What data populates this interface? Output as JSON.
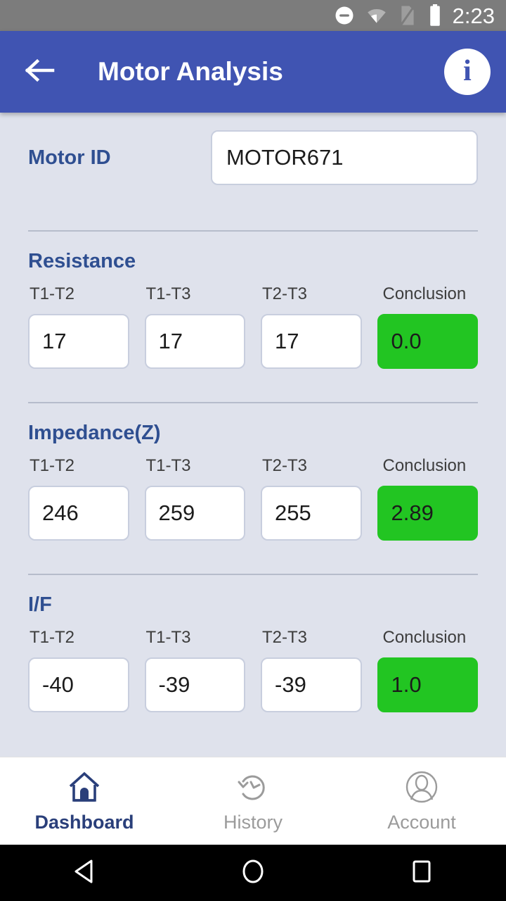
{
  "status_bar": {
    "time": "2:23",
    "icons": [
      "do-not-disturb-icon",
      "wifi-icon",
      "no-sim-icon",
      "battery-icon"
    ],
    "background": "#7c7c7c"
  },
  "app_bar": {
    "title": "Motor Analysis",
    "back_icon": "arrow-left-icon",
    "info_icon": "info-icon",
    "info_glyph": "i",
    "background": "#4054b2"
  },
  "motor": {
    "label": "Motor ID",
    "value": "MOTOR671",
    "placeholder": "Motor ID"
  },
  "column_headers": [
    "T1-T2",
    "T1-T3",
    "T2-T3",
    "Conclusion"
  ],
  "sections": [
    {
      "title": "Resistance",
      "headers": [
        "T1-T2",
        "T1-T3",
        "T2-T3",
        "Conclusion"
      ],
      "values": [
        "17",
        "17",
        "17"
      ],
      "conclusion": "0.0",
      "conclusion_color": "#22c522"
    },
    {
      "title": "Impedance(Z)",
      "headers": [
        "T1-T2",
        "T1-T3",
        "T2-T3",
        "Conclusion"
      ],
      "values": [
        "246",
        "259",
        "255"
      ],
      "conclusion": "2.89",
      "conclusion_color": "#22c522"
    },
    {
      "title": "I/F",
      "headers": [
        "T1-T2",
        "T1-T3",
        "T2-T3",
        "Conclusion"
      ],
      "values": [
        "-40",
        "-39",
        "-39"
      ],
      "conclusion": "1.0",
      "conclusion_color": "#22c522"
    }
  ],
  "bottom_nav": {
    "active_color": "#2a3f7a",
    "inactive_color": "#9b9b9b",
    "items": [
      {
        "label": "Dashboard",
        "icon": "home-icon",
        "active": true
      },
      {
        "label": "History",
        "icon": "history-icon",
        "active": false
      },
      {
        "label": "Account",
        "icon": "account-icon",
        "active": false
      }
    ]
  },
  "android_nav": {
    "buttons": [
      {
        "icon": "back-triangle-icon"
      },
      {
        "icon": "home-circle-icon"
      },
      {
        "icon": "recents-square-icon"
      }
    ]
  }
}
